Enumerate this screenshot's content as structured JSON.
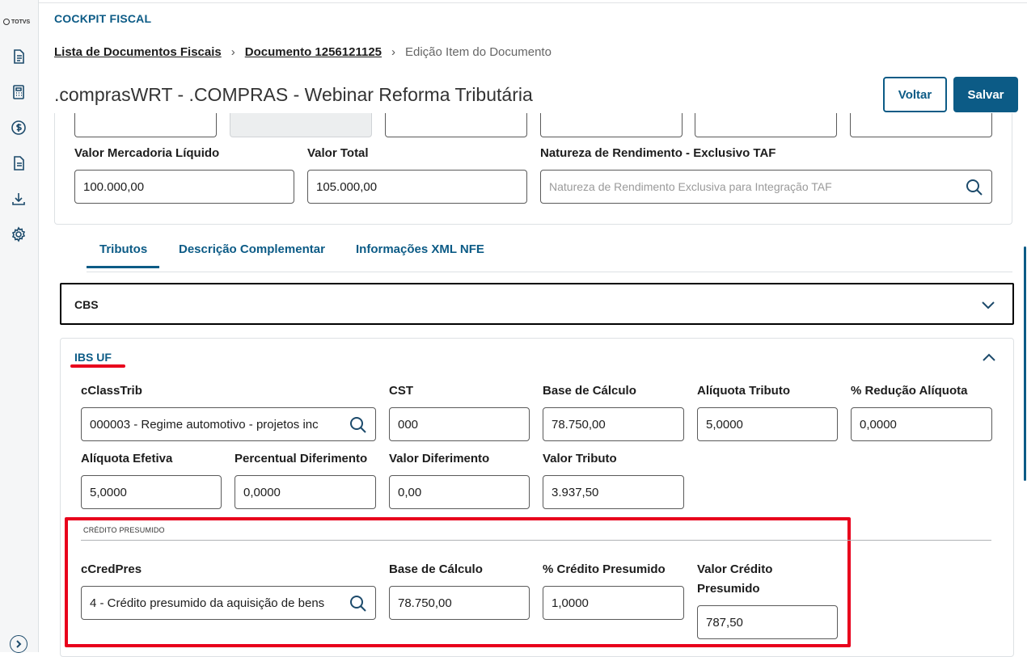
{
  "brand": {
    "logo_text": "TOTVS"
  },
  "sidebar": {
    "icons": [
      "document-icon",
      "calculator-icon",
      "dollar-icon",
      "file-icon",
      "download-icon",
      "gear-icon"
    ]
  },
  "header": {
    "app_title": "COCKPIT FISCAL"
  },
  "breadcrumb": {
    "items": [
      "Lista de Documentos Fiscais",
      "Documento 1256121125",
      "Edição Item do Documento"
    ]
  },
  "page": {
    "title": ".comprasWRT - .COMPRAS - Webinar Reforma Tributária"
  },
  "actions": {
    "back_label": "Voltar",
    "save_label": "Salvar"
  },
  "item_card": {
    "valor_mercadoria_label": "Valor Mercadoria Líquido",
    "valor_mercadoria_value": "100.000,00",
    "valor_total_label": "Valor Total",
    "valor_total_value": "105.000,00",
    "natureza_label": "Natureza de Rendimento - Exclusivo TAF",
    "natureza_placeholder": "Natureza de Rendimento Exclusiva para Integração TAF"
  },
  "tabs": [
    "Tributos",
    "Descrição Complementar",
    "Informações XML NFE"
  ],
  "cbs": {
    "label": "CBS"
  },
  "ibs": {
    "title": "IBS UF",
    "cclasstrib_label": "cClassTrib",
    "cclasstrib_value": "000003 - Regime automotivo - projetos inc",
    "cst_label": "CST",
    "cst_value": "000",
    "base_label": "Base de Cálculo",
    "base_value": "78.750,00",
    "aliquota_label": "Alíquota Tributo",
    "aliquota_value": "5,0000",
    "reducao_label": "% Redução Alíquota",
    "reducao_value": "0,0000",
    "efetiva_label": "Alíquota Efetiva",
    "efetiva_value": "5,0000",
    "perc_dif_label": "Percentual Diferimento",
    "perc_dif_value": "0,0000",
    "valor_dif_label": "Valor Diferimento",
    "valor_dif_value": "0,00",
    "valor_trib_label": "Valor Tributo",
    "valor_trib_value": "3.937,50"
  },
  "credito": {
    "section_title": "CRÉDITO PRESUMIDO",
    "ccredpres_label": "cCredPres",
    "ccredpres_value": "4 - Crédito presumido da aquisição de bens",
    "base_label": "Base de Cálculo",
    "base_value": "78.750,00",
    "perc_label": "% Crédito Presumido",
    "perc_value": "1,0000",
    "valor_label_1": "Valor Crédito",
    "valor_label_2": "Presumido",
    "valor_value": "787,50"
  },
  "colors": {
    "primary": "#0c5b86",
    "highlight": "#e8001c"
  }
}
